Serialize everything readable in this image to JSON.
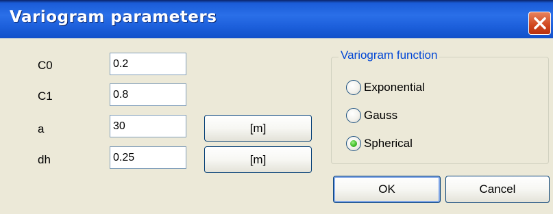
{
  "window": {
    "title": "Variogram parameters",
    "close_icon": "close-icon"
  },
  "params": [
    {
      "label": "C0",
      "value": "0.2"
    },
    {
      "label": "C1",
      "value": "0.8"
    },
    {
      "label": "a",
      "value": "30"
    },
    {
      "label": "dh",
      "value": "0.25"
    }
  ],
  "unit_buttons": {
    "a_unit": "[m]",
    "dh_unit": "[m]"
  },
  "variogram_function": {
    "legend": "Variogram function",
    "options": [
      {
        "label": "Exponential",
        "selected": false
      },
      {
        "label": "Gauss",
        "selected": false
      },
      {
        "label": "Spherical",
        "selected": true
      }
    ]
  },
  "actions": {
    "ok_label": "OK",
    "cancel_label": "Cancel"
  },
  "colors": {
    "title_bar": "#2a6fe8",
    "dialog_bg": "#ece9d8",
    "legend_text": "#0046d5",
    "close_button": "#d0461e",
    "radio_selected": "#3dbb25"
  }
}
